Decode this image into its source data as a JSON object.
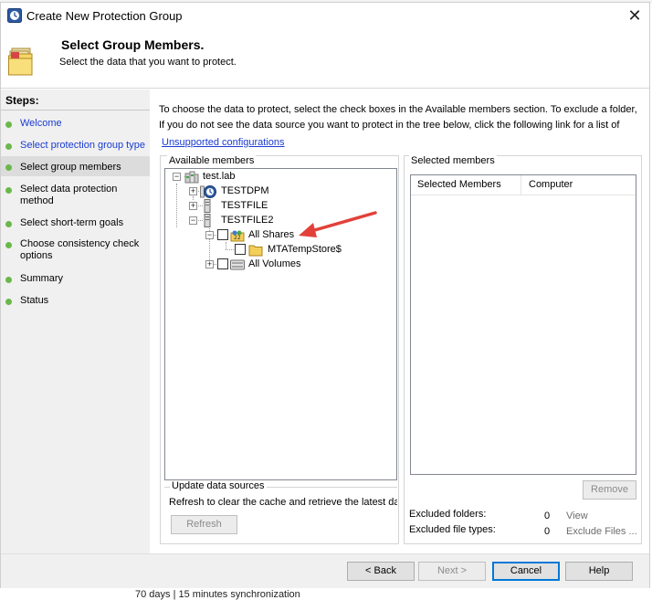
{
  "background": {
    "footer_text": "70 days | 15 minutes synchronization"
  },
  "window": {
    "title": "Create New Protection Group",
    "close": "✕"
  },
  "header": {
    "title": "Select Group Members.",
    "subtitle": "Select the data that you want to protect."
  },
  "steps": {
    "heading": "Steps:",
    "items": [
      {
        "label": "Welcome",
        "state": "link"
      },
      {
        "label": "Select protection group type",
        "state": "link"
      },
      {
        "label": "Select group members",
        "state": "current"
      },
      {
        "label": "Select data protection method",
        "state": "normal"
      },
      {
        "label": "Select short-term goals",
        "state": "normal"
      },
      {
        "label": "Choose consistency check options",
        "state": "normal"
      },
      {
        "label": "Summary",
        "state": "normal"
      },
      {
        "label": "Status",
        "state": "normal"
      }
    ],
    "dot_color": "#6ab84a",
    "link_color": "#1a3bd1"
  },
  "main": {
    "intro_line1": "To choose the data to protect, select the check boxes in the Available members section. To exclude a folder,",
    "intro_line2": "If you do not see the data source you want to protect in the tree below, click the following link for a list of",
    "unsupported_link": "Unsupported configurations",
    "available": {
      "title": "Available members",
      "tree": {
        "root": "test.lab",
        "servers": [
          "TESTDPM",
          "TESTFILE",
          "TESTFILE2"
        ],
        "all_shares": "All Shares",
        "share": "MTATempStore$",
        "all_volumes": "All Volumes"
      }
    },
    "update": {
      "title": "Update data sources",
      "desc": "Refresh to clear the cache and retrieve the latest data",
      "refresh": "Refresh"
    },
    "selected": {
      "title": "Selected members",
      "col_members": "Selected Members",
      "col_computer": "Computer",
      "remove": "Remove",
      "excluded_folders_label": "Excluded folders:",
      "excluded_folders_count": "0",
      "excluded_folders_link": "View",
      "excluded_types_label": "Excluded file types:",
      "excluded_types_count": "0",
      "excluded_types_link": "Exclude Files ..."
    }
  },
  "footer": {
    "back": "< Back",
    "next": "Next >",
    "cancel": "Cancel",
    "help": "Help"
  },
  "annotation": {
    "arrow_color": "#e2413a"
  }
}
